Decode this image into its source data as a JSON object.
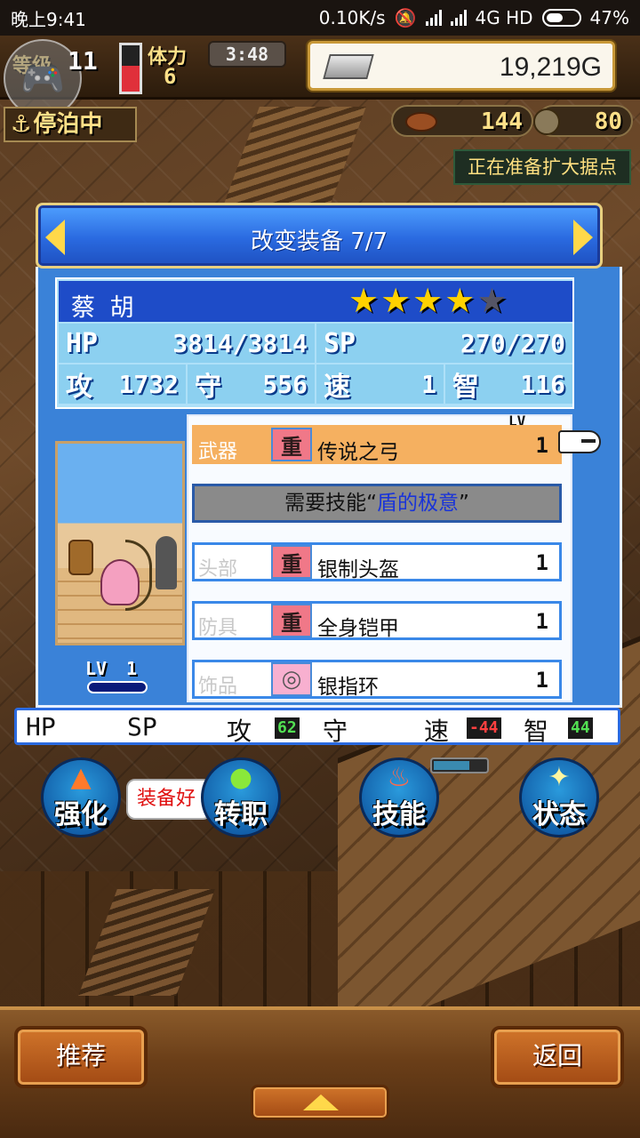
{
  "status_bar": {
    "time": "晚上9:41",
    "net_speed": "0.10K/s",
    "network": "4G HD",
    "battery": "47%"
  },
  "hud": {
    "level_label": "等级",
    "level": "11",
    "stamina_label": "体力",
    "stamina": "6",
    "stamina_fill": 0.55,
    "clock": "3:48",
    "gold": "19,219G",
    "docked_label": "停泊中",
    "resource_1": "144",
    "resource_2": "80",
    "notice": "正在准备扩大据点"
  },
  "dialog": {
    "title": "改变装备 7/7",
    "character": {
      "name": "蔡 胡",
      "stars": 4,
      "stars_max": 5,
      "hp_label": "HP",
      "hp": "3814/3814",
      "sp_label": "SP",
      "sp": "270/270",
      "atk_label": "攻",
      "atk": "1732",
      "def_label": "守",
      "def": "556",
      "spd_label": "速",
      "spd": "1",
      "int_label": "智",
      "int": "116",
      "lv_label": "LV",
      "lv": "1"
    },
    "lv_header": "LV",
    "slots": [
      {
        "category": "武器",
        "badge": "重",
        "item": "传说之弓",
        "lv": "1"
      },
      {
        "category": "头部",
        "badge": "重",
        "item": "银制头盔",
        "lv": "1"
      },
      {
        "category": "防具",
        "badge": "重",
        "item": "全身铠甲",
        "lv": "1"
      },
      {
        "category": "饰品",
        "badge": "◎",
        "item": "银指环",
        "lv": "1"
      }
    ],
    "requirement": {
      "prefix": "需要技能“",
      "skill": "盾的极意",
      "suffix": "”"
    },
    "deltas": {
      "hp_label": "HP",
      "sp_label": "SP",
      "atk_label": "攻",
      "atk": "62",
      "def_label": "守",
      "spd_label": "速",
      "spd": "-44",
      "int_label": "智",
      "int": "44"
    }
  },
  "actions": {
    "strengthen": "强化",
    "tooltip": "装备好",
    "job_change": "转职",
    "skills": "技能",
    "status": "状态"
  },
  "bottom": {
    "recommend": "推荐",
    "back": "返回"
  },
  "colors": {
    "accent_blue": "#2a6ae0",
    "selected_slot": "#f5b060",
    "gold_star": "#ffd200",
    "skill_text": "#1a34d8"
  }
}
